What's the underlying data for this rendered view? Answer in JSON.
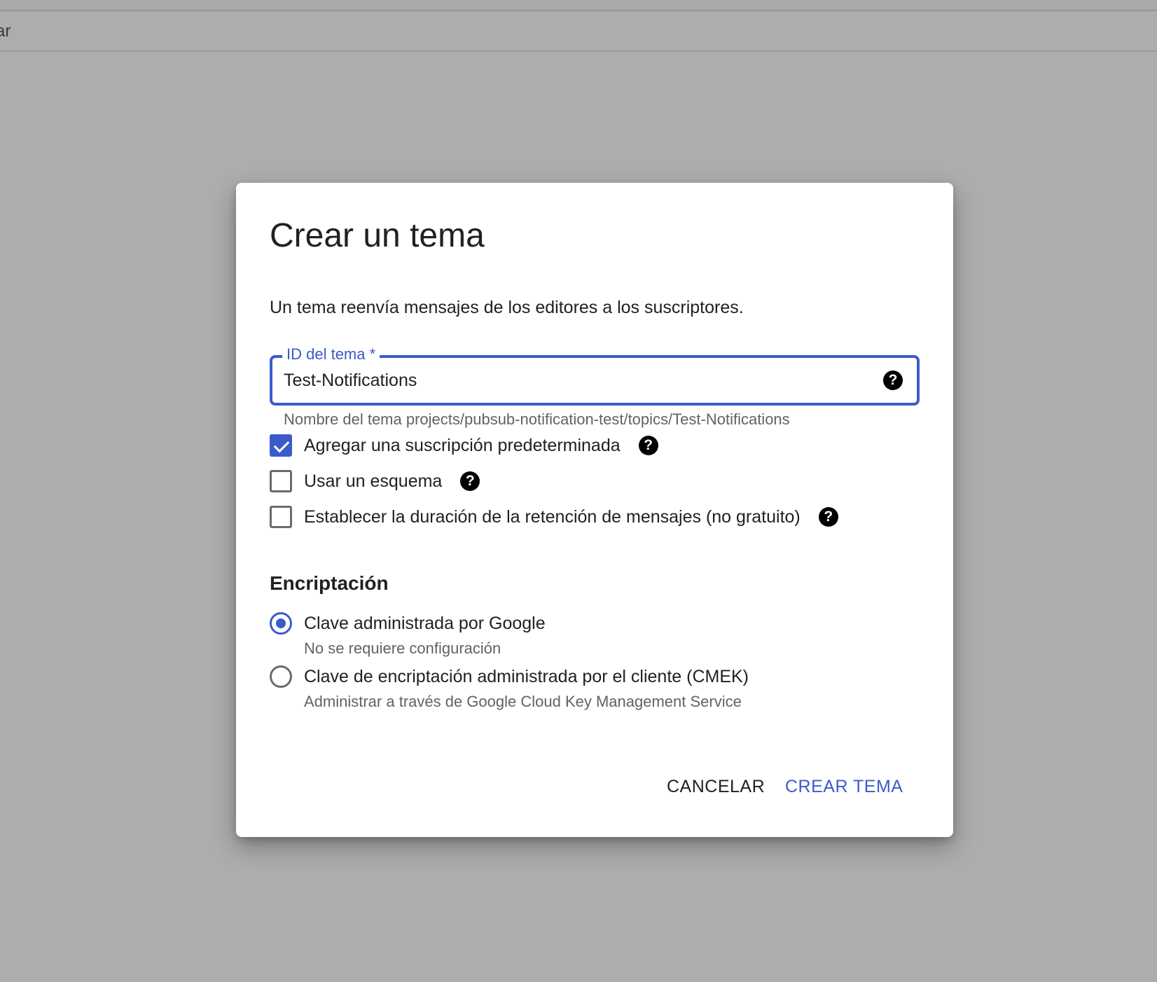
{
  "background": {
    "subbar_text": "ar"
  },
  "dialog": {
    "title": "Crear un tema",
    "description": "Un tema reenvía mensajes de los editores a los suscriptores.",
    "topic_field": {
      "label": "ID del tema *",
      "value": "Test-Notifications",
      "hint": "Nombre del tema projects/pubsub-notification-test/topics/Test-Notifications"
    },
    "checkboxes": [
      {
        "label": "Agregar una suscripción predeterminada",
        "checked": true
      },
      {
        "label": "Usar un esquema",
        "checked": false
      },
      {
        "label": "Establecer la duración de la retención de mensajes (no gratuito)",
        "checked": false
      }
    ],
    "encryption": {
      "title": "Encriptación",
      "options": [
        {
          "label": "Clave administrada por Google",
          "sublabel": "No se requiere configuración",
          "selected": true
        },
        {
          "label": "Clave de encriptación administrada por el cliente (CMEK)",
          "sublabel": "Administrar a través de Google Cloud Key Management Service",
          "selected": false
        }
      ]
    },
    "buttons": {
      "cancel": "CANCELAR",
      "create": "CREAR TEMA"
    }
  },
  "icons": {
    "help": "?"
  },
  "colors": {
    "accent": "#3c5bcb",
    "overlay": "#adadad",
    "text_primary": "#202124",
    "text_secondary": "#5f6368"
  }
}
